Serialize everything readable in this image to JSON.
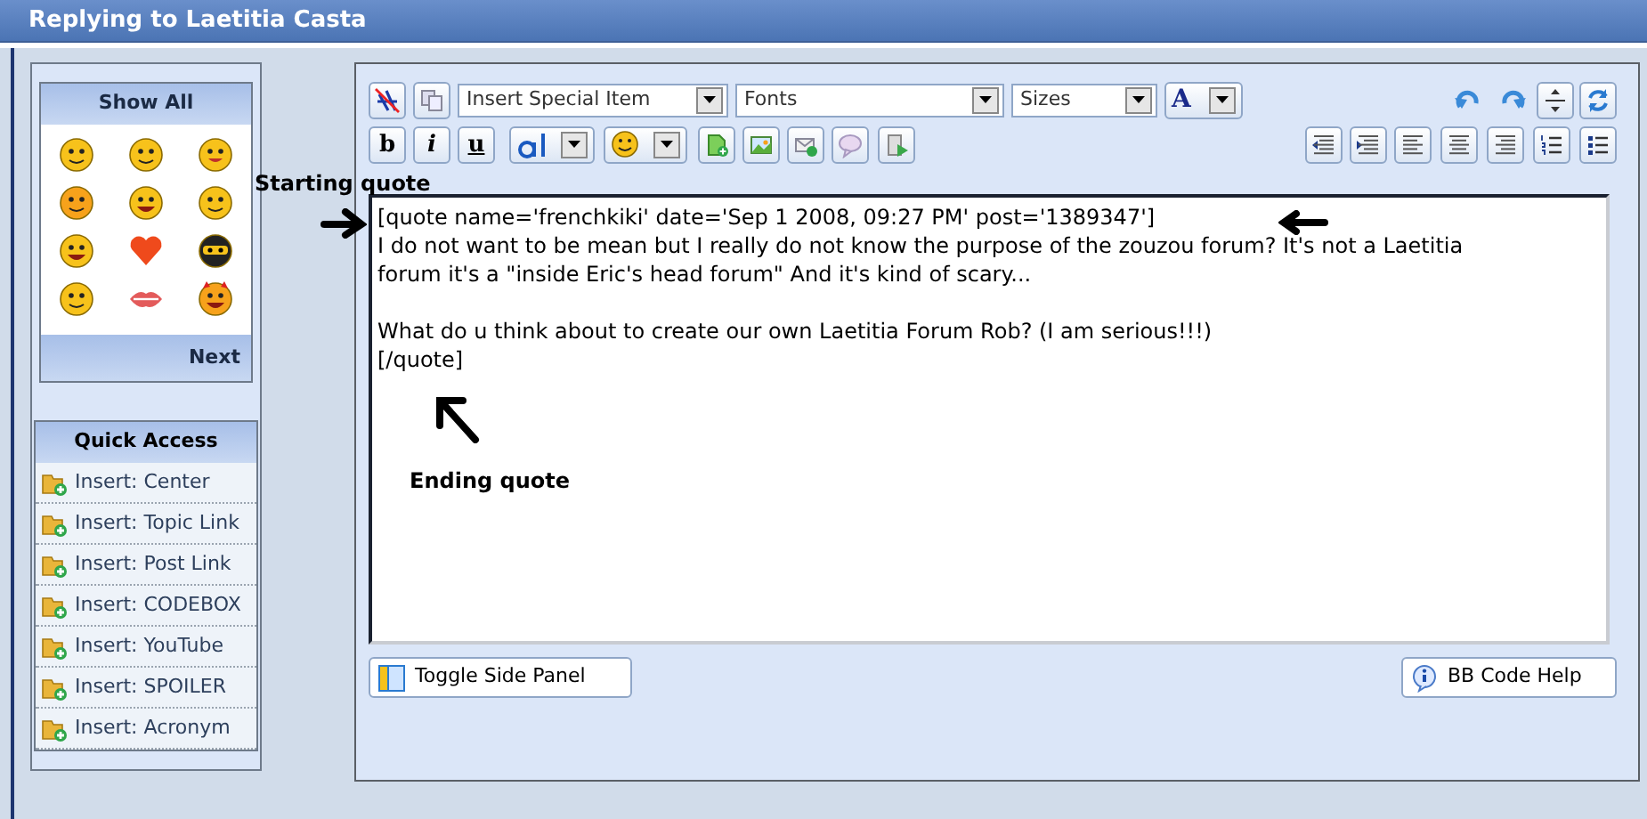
{
  "window": {
    "title": "Replying to Laetitia Casta"
  },
  "smilies_panel": {
    "header": "Show All",
    "footer": "Next"
  },
  "quick_access": {
    "title": "Quick Access",
    "items": [
      {
        "label": "Insert: Center"
      },
      {
        "label": "Insert: Topic Link"
      },
      {
        "label": "Insert: Post Link"
      },
      {
        "label": "Insert: CODEBOX"
      },
      {
        "label": "Insert: YouTube"
      },
      {
        "label": "Insert: SPOILER"
      },
      {
        "label": "Insert: Acronym"
      }
    ]
  },
  "toolbar": {
    "dropdowns": [
      {
        "label": "Insert Special Item"
      },
      {
        "label": "Fonts"
      },
      {
        "label": "Sizes"
      }
    ],
    "font_color_label": "A",
    "format_buttons": [
      {
        "label": "b",
        "kind": "bold"
      },
      {
        "label": "i",
        "kind": "italic"
      },
      {
        "label": "u",
        "kind": "underline"
      }
    ]
  },
  "editor": {
    "paragraphs": [
      [
        "[quote name='frenchkiki' date='Sep 1 2008, 09:27 PM' post='1389347']",
        "I do not want to be mean but I really do not know the purpose of the zouzou forum? It's not a Laetitia",
        "forum it's a \"inside Eric's head forum\" And it's kind of scary..."
      ],
      [
        "What do u think about to create our own Laetitia Forum Rob? (I am serious!!!)",
        "[/quote]"
      ]
    ]
  },
  "buttons": [
    {
      "label": "Toggle Side Panel",
      "kind": "toggle"
    },
    {
      "label": "BB Code Help",
      "kind": "help"
    }
  ],
  "annotations": [
    {
      "kind": "start",
      "label": "Starting quote"
    },
    {
      "kind": "end",
      "label": "Ending quote"
    }
  ]
}
